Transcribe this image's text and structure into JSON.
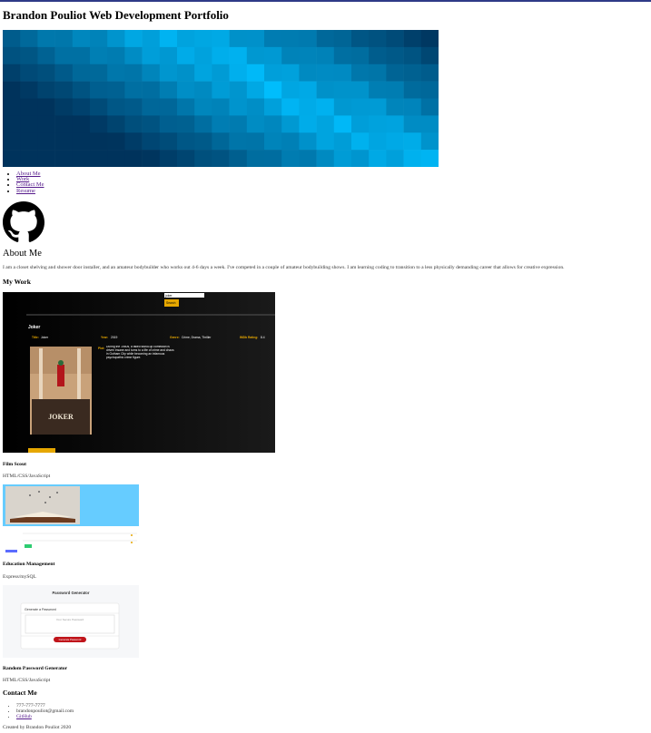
{
  "header": {
    "title": "Brandon Pouliot Web Development Portfolio"
  },
  "nav": {
    "items": [
      "About Me",
      "Work",
      "Contact Me",
      "Resume"
    ]
  },
  "about": {
    "heading": "About Me",
    "text": "I am a closet shelving and shower door installer, and an amateur bodybuilder who works out 4-6 days a week. I've competed in a couple of amateur bodybuilding shows. I am learning coding to transition to a less physically demanding career that allows for creative expression."
  },
  "work": {
    "heading": "My Work",
    "projects": [
      {
        "name": "Film Scout",
        "tech": "HTML/CSS/JavaScript"
      },
      {
        "name": "Education Management",
        "tech": "Express/mySQL"
      },
      {
        "name": "Random Password Generator",
        "tech": "HTML/CSS/JavaScript"
      }
    ]
  },
  "film_scout_shot": {
    "search_value": "joker",
    "search_button": "Search",
    "movie_title": "Joker",
    "title_label": "Title:",
    "title_value": "Joker",
    "year_label": "Year:",
    "year_value": "2019",
    "genre_label": "Genre:",
    "genre_value": "Crime, Drama, Thriller",
    "rating_label": "IMDb Rating:",
    "rating_value": "8.4",
    "plot_label": "Plot:",
    "plot_value": "During the 1980s, a failed stand-up comedian is driven insane and turns to a life of crime and chaos in Gotham City while becoming an infamous psychopathic crime figure.",
    "poster_text": "JOKER"
  },
  "password_shot": {
    "header": "Password Generator",
    "card_title": "Generate a Password",
    "placeholder": "Your Secure Password",
    "button": "Generate Password"
  },
  "contact": {
    "heading": "Contact Me",
    "phone": "777-777-7777",
    "email": "brandonpouliot@gmail.com",
    "github": "GitHub"
  },
  "footer": {
    "text": "Created by Brandon Pouliot 2020"
  },
  "colors": {
    "top_border": "#2e3a87",
    "banner_light": "#00bfff",
    "banner_dark": "#00335c",
    "link": "#551a8b"
  }
}
